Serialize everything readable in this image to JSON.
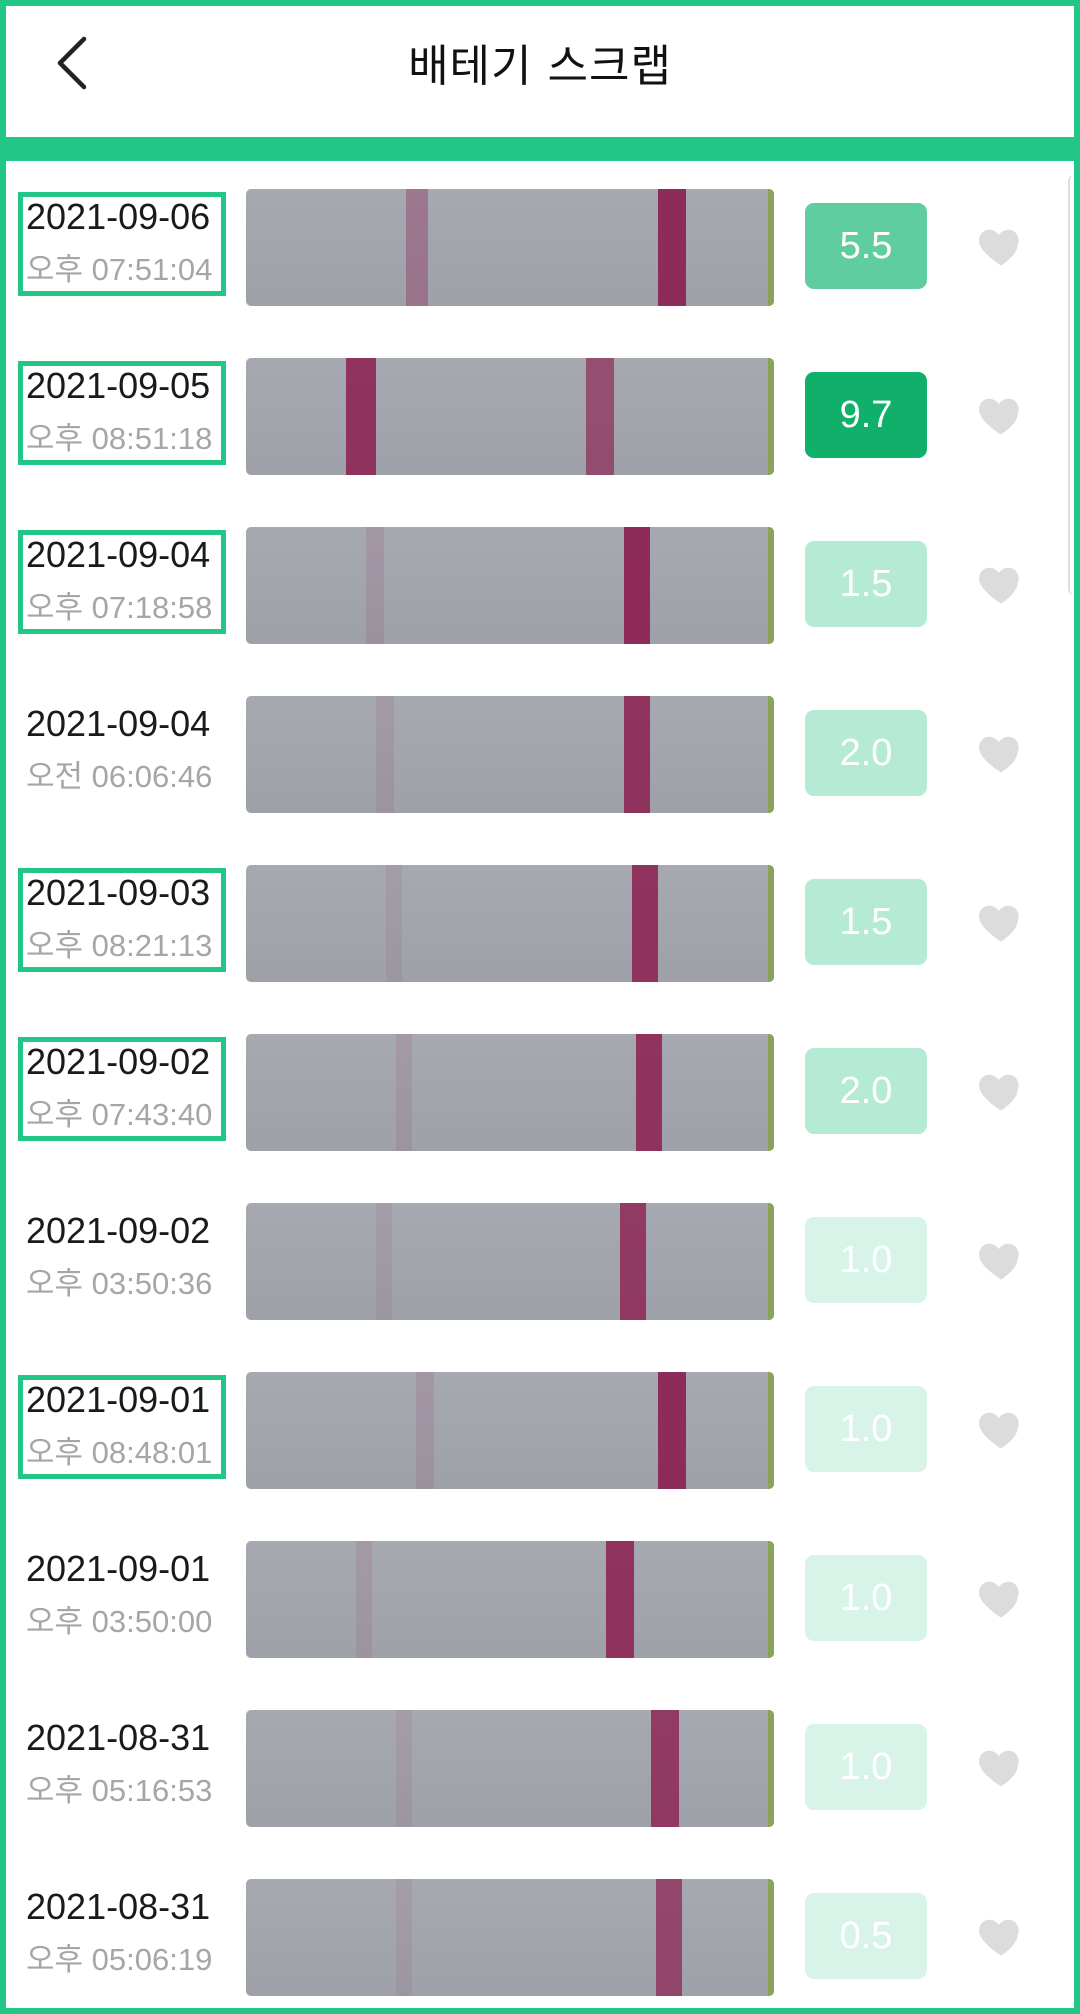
{
  "header": {
    "title": "배테기 스크랩",
    "back_icon": "chevron-left-icon"
  },
  "colors": {
    "accent": "#22c787",
    "score_dark": "#10b06b",
    "score_mid": "#5fcd9f",
    "score_light": "#b5ead4",
    "score_faint": "#d8f4e8"
  },
  "records": [
    {
      "date": "2021-09-06",
      "time": "오후 07:51:04",
      "score": "5.5",
      "highlight": true,
      "favorite_icon": "heart-icon"
    },
    {
      "date": "2021-09-05",
      "time": "오후 08:51:18",
      "score": "9.7",
      "highlight": true,
      "favorite_icon": "heart-icon"
    },
    {
      "date": "2021-09-04",
      "time": "오후 07:18:58",
      "score": "1.5",
      "highlight": true,
      "favorite_icon": "heart-icon"
    },
    {
      "date": "2021-09-04",
      "time": "오전 06:06:46",
      "score": "2.0",
      "highlight": false,
      "favorite_icon": "heart-icon"
    },
    {
      "date": "2021-09-03",
      "time": "오후 08:21:13",
      "score": "1.5",
      "highlight": true,
      "favorite_icon": "heart-icon"
    },
    {
      "date": "2021-09-02",
      "time": "오후 07:43:40",
      "score": "2.0",
      "highlight": true,
      "favorite_icon": "heart-icon"
    },
    {
      "date": "2021-09-02",
      "time": "오후 03:50:36",
      "score": "1.0",
      "highlight": false,
      "favorite_icon": "heart-icon"
    },
    {
      "date": "2021-09-01",
      "time": "오후 08:48:01",
      "score": "1.0",
      "highlight": true,
      "favorite_icon": "heart-icon"
    },
    {
      "date": "2021-09-01",
      "time": "오후 03:50:00",
      "score": "1.0",
      "highlight": false,
      "favorite_icon": "heart-icon"
    },
    {
      "date": "2021-08-31",
      "time": "오후 05:16:53",
      "score": "1.0",
      "highlight": false,
      "favorite_icon": "heart-icon"
    },
    {
      "date": "2021-08-31",
      "time": "오후 05:06:19",
      "score": "0.5",
      "highlight": false,
      "favorite_icon": "heart-icon"
    }
  ]
}
